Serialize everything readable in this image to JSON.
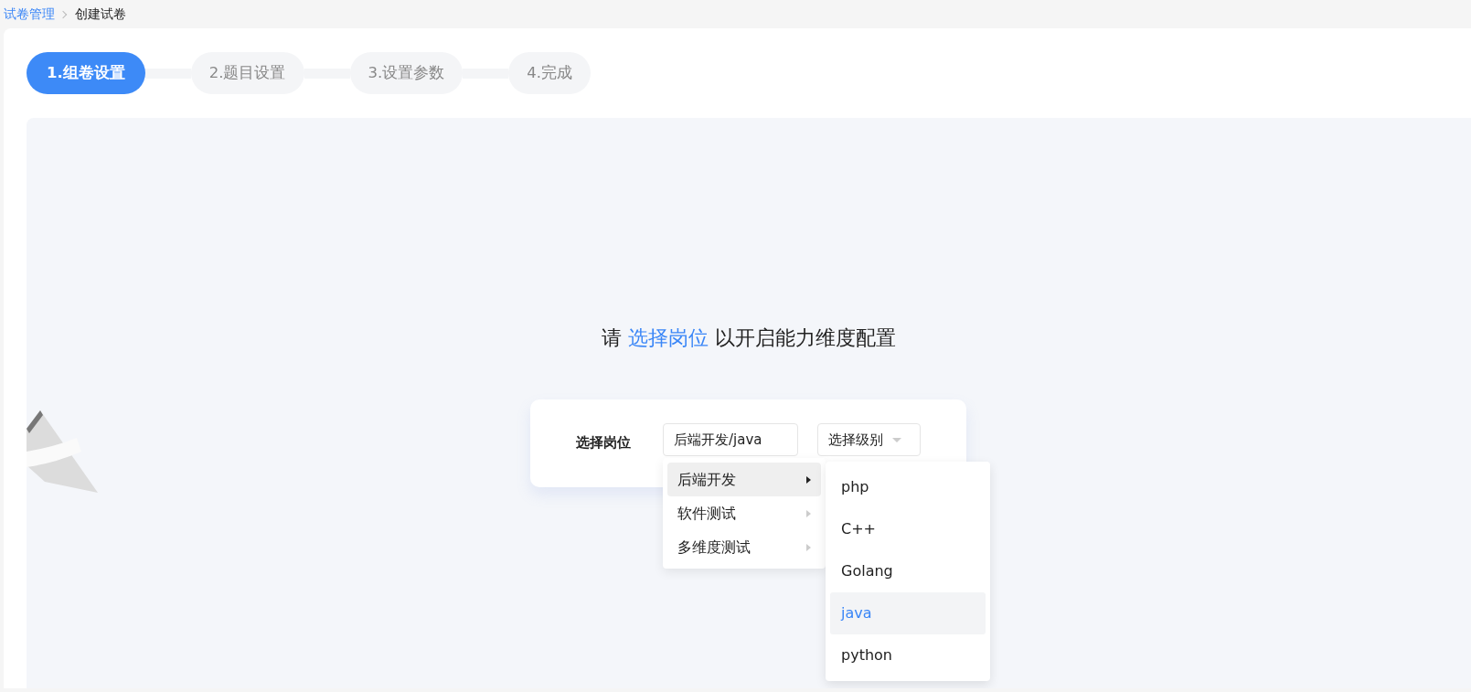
{
  "breadcrumb": [
    {
      "label": "试卷管理",
      "kind": "link"
    },
    {
      "label": "创建试卷",
      "kind": "current"
    }
  ],
  "steps": [
    {
      "label": "1.组卷设置",
      "selected": true
    },
    {
      "label": "2.题目设置",
      "selected": false
    },
    {
      "label": "3.设置参数",
      "selected": false
    },
    {
      "label": "4.完成",
      "selected": false
    }
  ],
  "prompt": {
    "before": "请",
    "link": "选择岗位",
    "after": "以开启能力维度配置"
  },
  "form": {
    "label": "选择岗位",
    "position_value": "后端开发/java",
    "level_placeholder": "选择级别"
  },
  "cascader": {
    "categories": [
      {
        "label": "后端开发",
        "selected": true
      },
      {
        "label": "软件测试",
        "selected": false
      },
      {
        "label": "多维度测试",
        "selected": false
      }
    ],
    "options": [
      {
        "label": "php",
        "selected": false
      },
      {
        "label": "C++",
        "selected": false
      },
      {
        "label": "Golang",
        "selected": false
      },
      {
        "label": "java",
        "selected": true
      },
      {
        "label": "python",
        "selected": false
      }
    ]
  }
}
